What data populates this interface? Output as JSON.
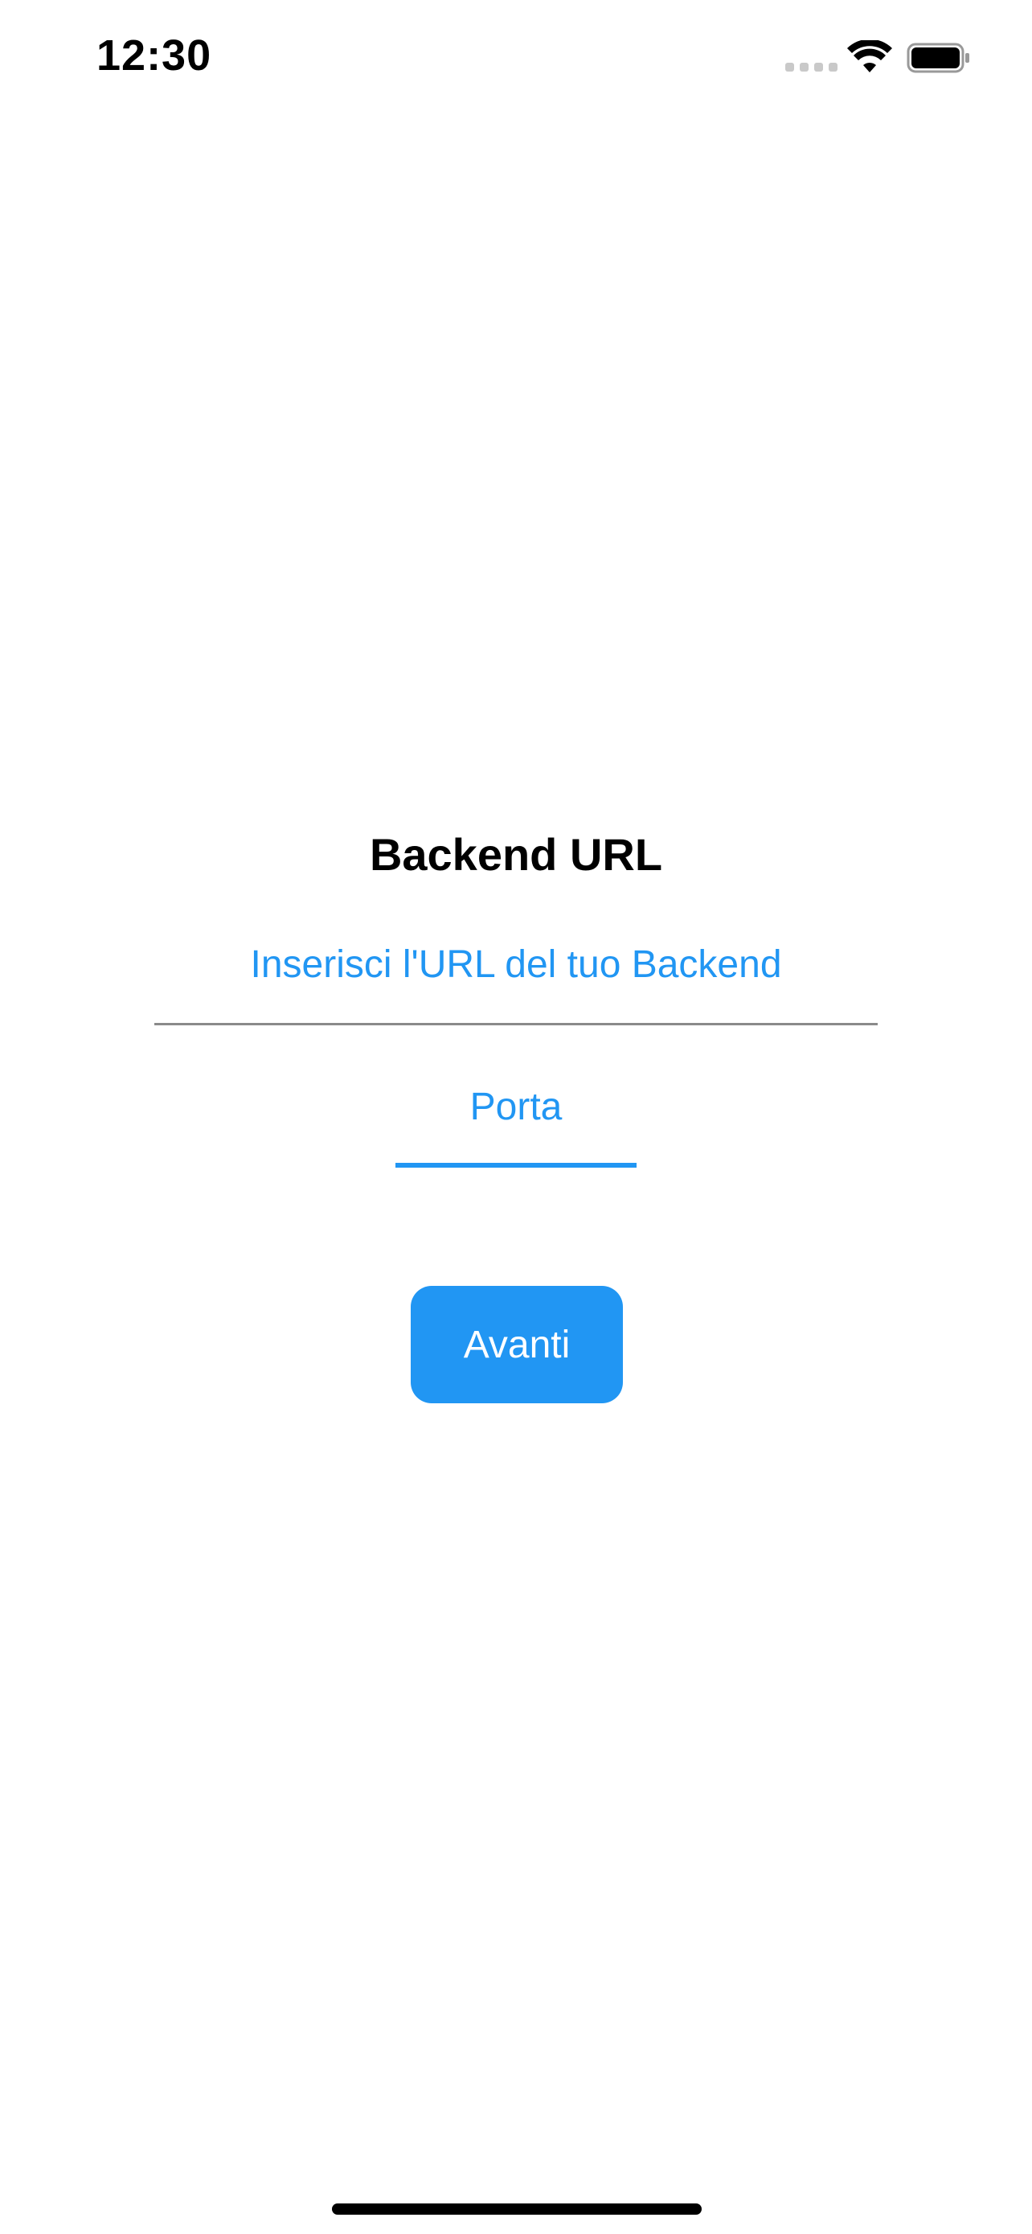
{
  "status_bar": {
    "time": "12:30",
    "icons": [
      "cellular-signal-icon",
      "wifi-icon",
      "battery-icon"
    ]
  },
  "main": {
    "title": "Backend URL",
    "url_field": {
      "placeholder": "Inserisci l'URL del tuo Backend",
      "value": ""
    },
    "port_field": {
      "placeholder": "Porta",
      "value": ""
    },
    "next_button_label": "Avanti"
  },
  "colors": {
    "accent": "#2196f3",
    "background": "#ffffff",
    "title_text": "#000000",
    "divider": "#8a8a8a"
  }
}
